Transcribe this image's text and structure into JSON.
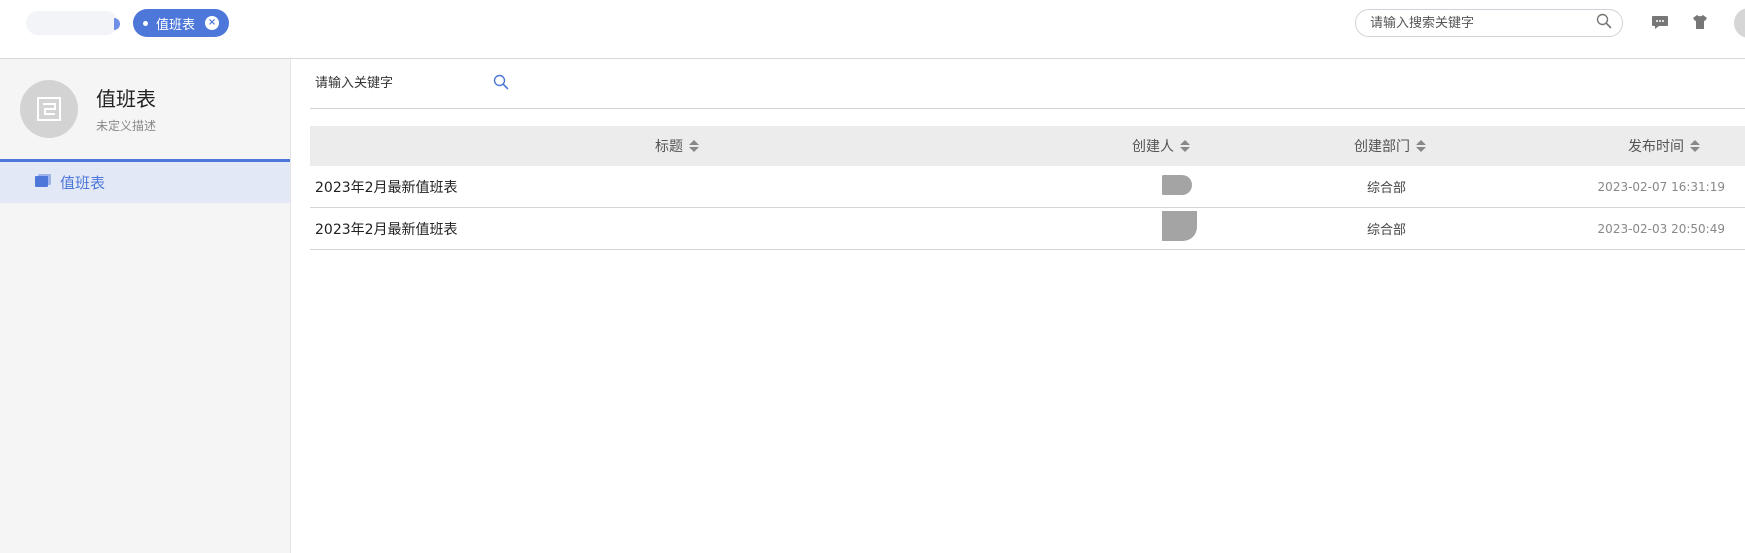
{
  "topbar": {
    "active_tab": {
      "label": "值班表"
    },
    "search": {
      "placeholder": "请输入搜索关键字"
    },
    "icons": [
      "message-icon",
      "theme-shirt-icon",
      "user-avatar"
    ]
  },
  "sidebar": {
    "app_title": "值班表",
    "app_description": "未定义描述",
    "items": [
      {
        "label": "值班表",
        "icon": "folder-icon",
        "active": true
      }
    ]
  },
  "main": {
    "search": {
      "placeholder": "请输入关键字"
    },
    "table": {
      "columns": [
        {
          "label": "标题",
          "sortable": true
        },
        {
          "label": "创建人",
          "sortable": true
        },
        {
          "label": "创建部门",
          "sortable": true
        },
        {
          "label": "发布时间",
          "sortable": true
        }
      ],
      "rows": [
        {
          "title": "2023年2月最新值班表",
          "creator": "",
          "department": "综合部",
          "published": "2023-02-07 16:31:19"
        },
        {
          "title": "2023年2月最新值班表",
          "creator": "",
          "department": "综合部",
          "published": "2023-02-03 20:50:49"
        }
      ]
    }
  },
  "colors": {
    "accent": "#4d77d8",
    "sidebar_bg": "#f5f5f5",
    "header_bg": "#ececec",
    "active_item_bg": "#e2e8f6"
  }
}
